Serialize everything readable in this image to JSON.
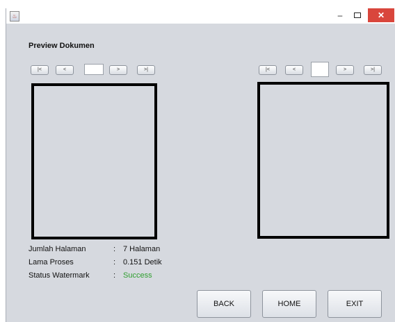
{
  "window": {
    "app_icon_glyph": "♨",
    "minimize_glyph": "–",
    "close_glyph": "✕"
  },
  "heading": "Preview Dokumen",
  "left_nav": {
    "first": "|<",
    "prev": "<",
    "page": "",
    "next": ">",
    "last": ">|"
  },
  "right_nav": {
    "first": "|<",
    "prev": "<",
    "page": "",
    "next": ">",
    "last": ">|"
  },
  "info": {
    "pages_label": "Jumlah Halaman",
    "pages_value": "7 Halaman",
    "time_label": "Lama Proses",
    "time_value": "0.151 Detik",
    "status_label": "Status Watermark",
    "status_value": "Success",
    "separator": ":"
  },
  "buttons": {
    "back": "BACK",
    "home": "HOME",
    "exit": "EXIT"
  },
  "colors": {
    "success": "#2e9e2e",
    "close": "#d9463c",
    "window_bg": "#d6d9df"
  }
}
